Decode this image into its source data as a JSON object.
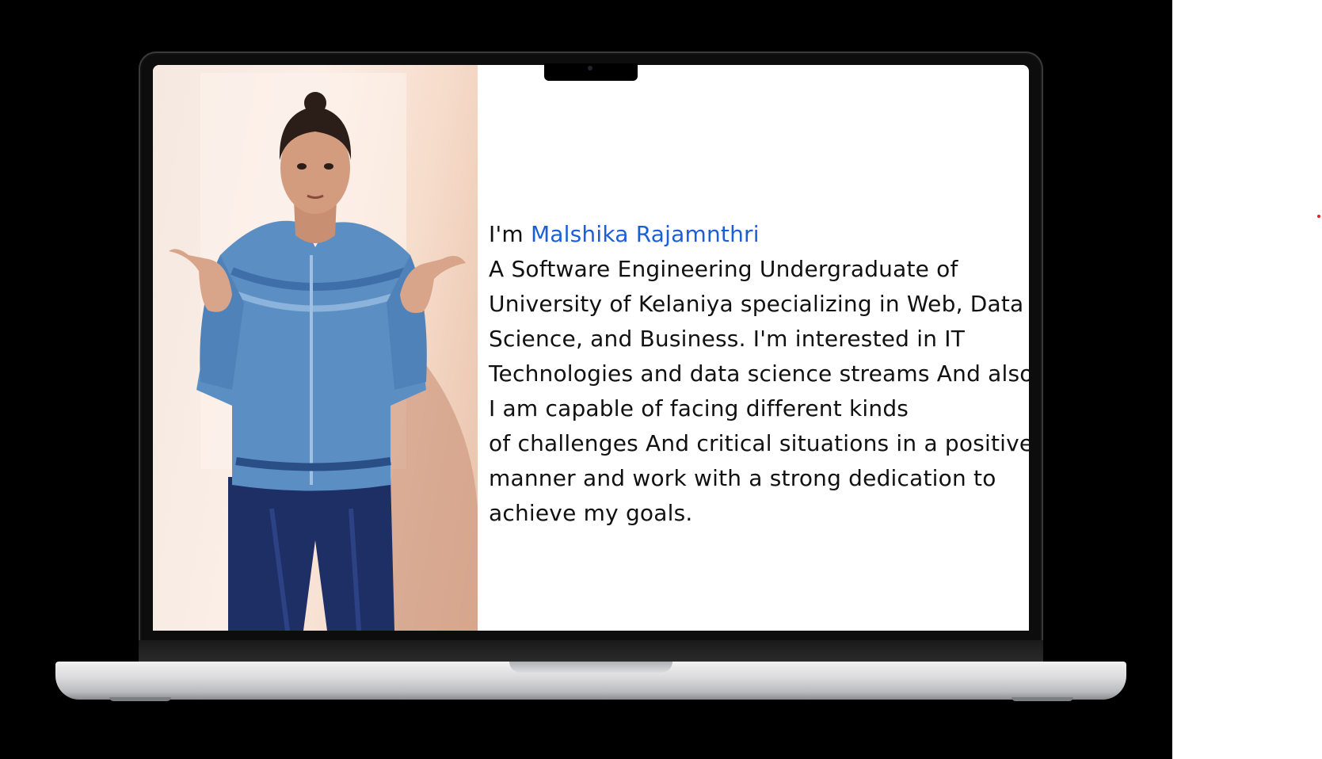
{
  "hero": {
    "greeting": "I'm",
    "name": "Malshika Rajamnthri",
    "bio_lines": [
      "A Software Engineering Undergraduate of",
      "University of Kelaniya specializing in Web, Data",
      "Science, and Business. I'm interested in IT",
      "Technologies and data science streams And also,",
      "I am capable of facing different kinds",
      "of challenges And critical situations in a positive",
      "manner and work with a strong dedication to",
      "achieve my goals."
    ]
  },
  "colors": {
    "name_accent": "#1a5fd6",
    "backdrop": "#000000",
    "screen": "#ffffff"
  },
  "icons": {
    "profile_photo": "portrait-photo",
    "camera": "webcam-icon"
  }
}
